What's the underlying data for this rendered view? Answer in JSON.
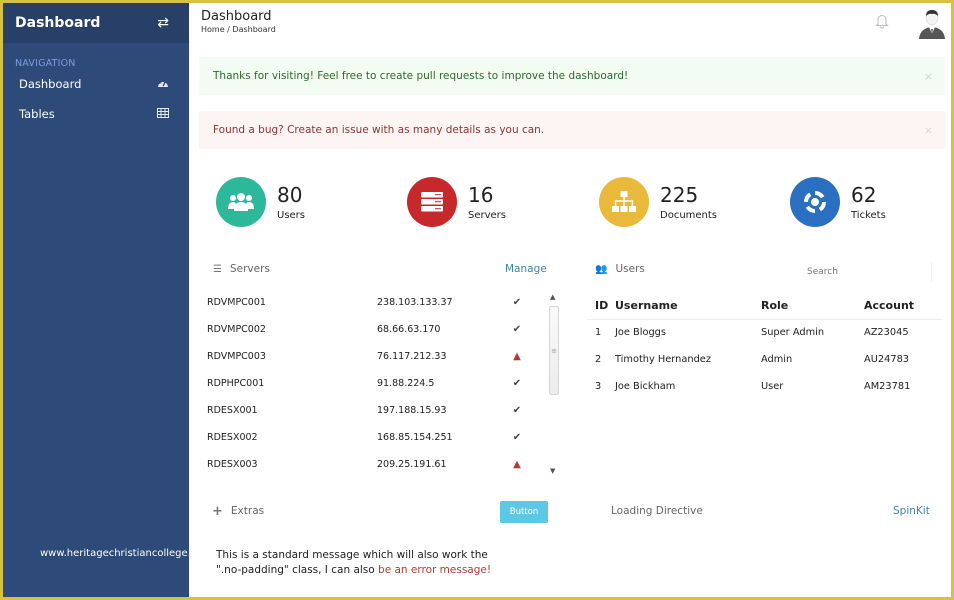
{
  "sidebar": {
    "brand": "Dashboard",
    "toggle_icon": "exchange-arrows-icon",
    "nav_title": "NAVIGATION",
    "items": [
      {
        "label": "Dashboard",
        "icon": "dashboard-gauge-icon"
      },
      {
        "label": "Tables",
        "icon": "table-grid-icon"
      }
    ],
    "watermark": "www.heritagechristiancollege.com"
  },
  "header": {
    "title": "Dashboard",
    "breadcrumb": "Home / Dashboard",
    "icons": [
      "bell-icon",
      "user-avatar-icon"
    ]
  },
  "alerts": [
    {
      "type": "success",
      "text": "Thanks for visiting! Feel free to create pull requests to improve the dashboard!",
      "close": "×"
    },
    {
      "type": "danger",
      "text": "Found a bug? Create an issue with as many details as you can.",
      "close": "×"
    }
  ],
  "stats": [
    {
      "value": "80",
      "label": "Users",
      "icon": "users-icon",
      "color": "#2eb89a"
    },
    {
      "value": "16",
      "label": "Servers",
      "icon": "server-icon",
      "color": "#c6282b"
    },
    {
      "value": "225",
      "label": "Documents",
      "icon": "sitemap-icon",
      "color": "#e8b93a"
    },
    {
      "value": "62",
      "label": "Tickets",
      "icon": "lifering-icon",
      "color": "#2a6fc0"
    }
  ],
  "servers": {
    "title": "Servers",
    "action": "Manage",
    "rows": [
      {
        "name": "RDVMPC001",
        "ip": "238.103.133.37",
        "status": "ok"
      },
      {
        "name": "RDVMPC002",
        "ip": "68.66.63.170",
        "status": "ok"
      },
      {
        "name": "RDVMPC003",
        "ip": "76.117.212.33",
        "status": "warning"
      },
      {
        "name": "RDPHPC001",
        "ip": "91.88.224.5",
        "status": "ok"
      },
      {
        "name": "RDESX001",
        "ip": "197.188.15.93",
        "status": "ok"
      },
      {
        "name": "RDESX002",
        "ip": "168.85.154.251",
        "status": "ok"
      },
      {
        "name": "RDESX003",
        "ip": "209.25.191.61",
        "status": "warning"
      }
    ],
    "status_glyphs": {
      "ok": "✔",
      "warning": "▲"
    }
  },
  "users": {
    "title": "Users",
    "search_placeholder": "Search",
    "columns": [
      "ID",
      "Username",
      "Role",
      "Account"
    ],
    "rows": [
      {
        "id": "1",
        "username": "Joe Bloggs",
        "role": "Super Admin",
        "account": "AZ23045"
      },
      {
        "id": "2",
        "username": "Timothy Hernandez",
        "role": "Admin",
        "account": "AU24783"
      },
      {
        "id": "3",
        "username": "Joe Bickham",
        "role": "User",
        "account": "AM23781"
      }
    ]
  },
  "extras": {
    "title": "Extras",
    "button": "Button",
    "message": "This is a standard message which will also work the \".no-padding\" class, I can also ",
    "error_text": "be an error message!"
  },
  "loading": {
    "title": "Loading Directive",
    "link": "SpinKit"
  }
}
